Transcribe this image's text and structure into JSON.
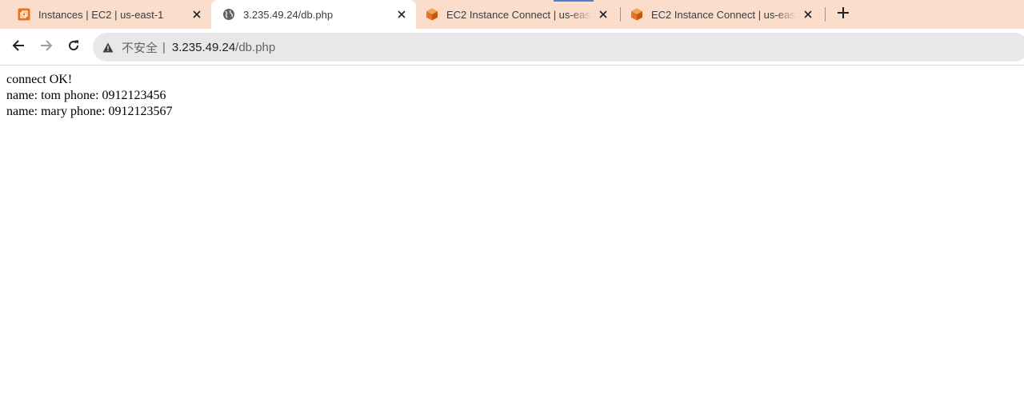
{
  "tabs": [
    {
      "title": "Instances | EC2 | us-east-1",
      "icon": "aws-ec2-icon",
      "active": false
    },
    {
      "title": "3.235.49.24/db.php",
      "icon": "globe-icon",
      "active": true
    },
    {
      "title": "EC2 Instance Connect | us-east",
      "icon": "aws-cube-icon",
      "active": false
    },
    {
      "title": "EC2 Instance Connect | us-east",
      "icon": "aws-cube-icon",
      "active": false
    }
  ],
  "address_bar": {
    "security_label": "不安全",
    "divider": "|",
    "host": "3.235.49.24",
    "path": "/db.php"
  },
  "page": {
    "lines": [
      "connect OK!",
      "name: tom phone: 0912123456",
      "name: mary phone: 0912123567"
    ]
  },
  "colors": {
    "tabstrip_bg": "#fbddcb",
    "aws_orange": "#e8731c",
    "omnibox_bg": "#e8e8e8",
    "loading_indicator": "#4a7fd6"
  }
}
